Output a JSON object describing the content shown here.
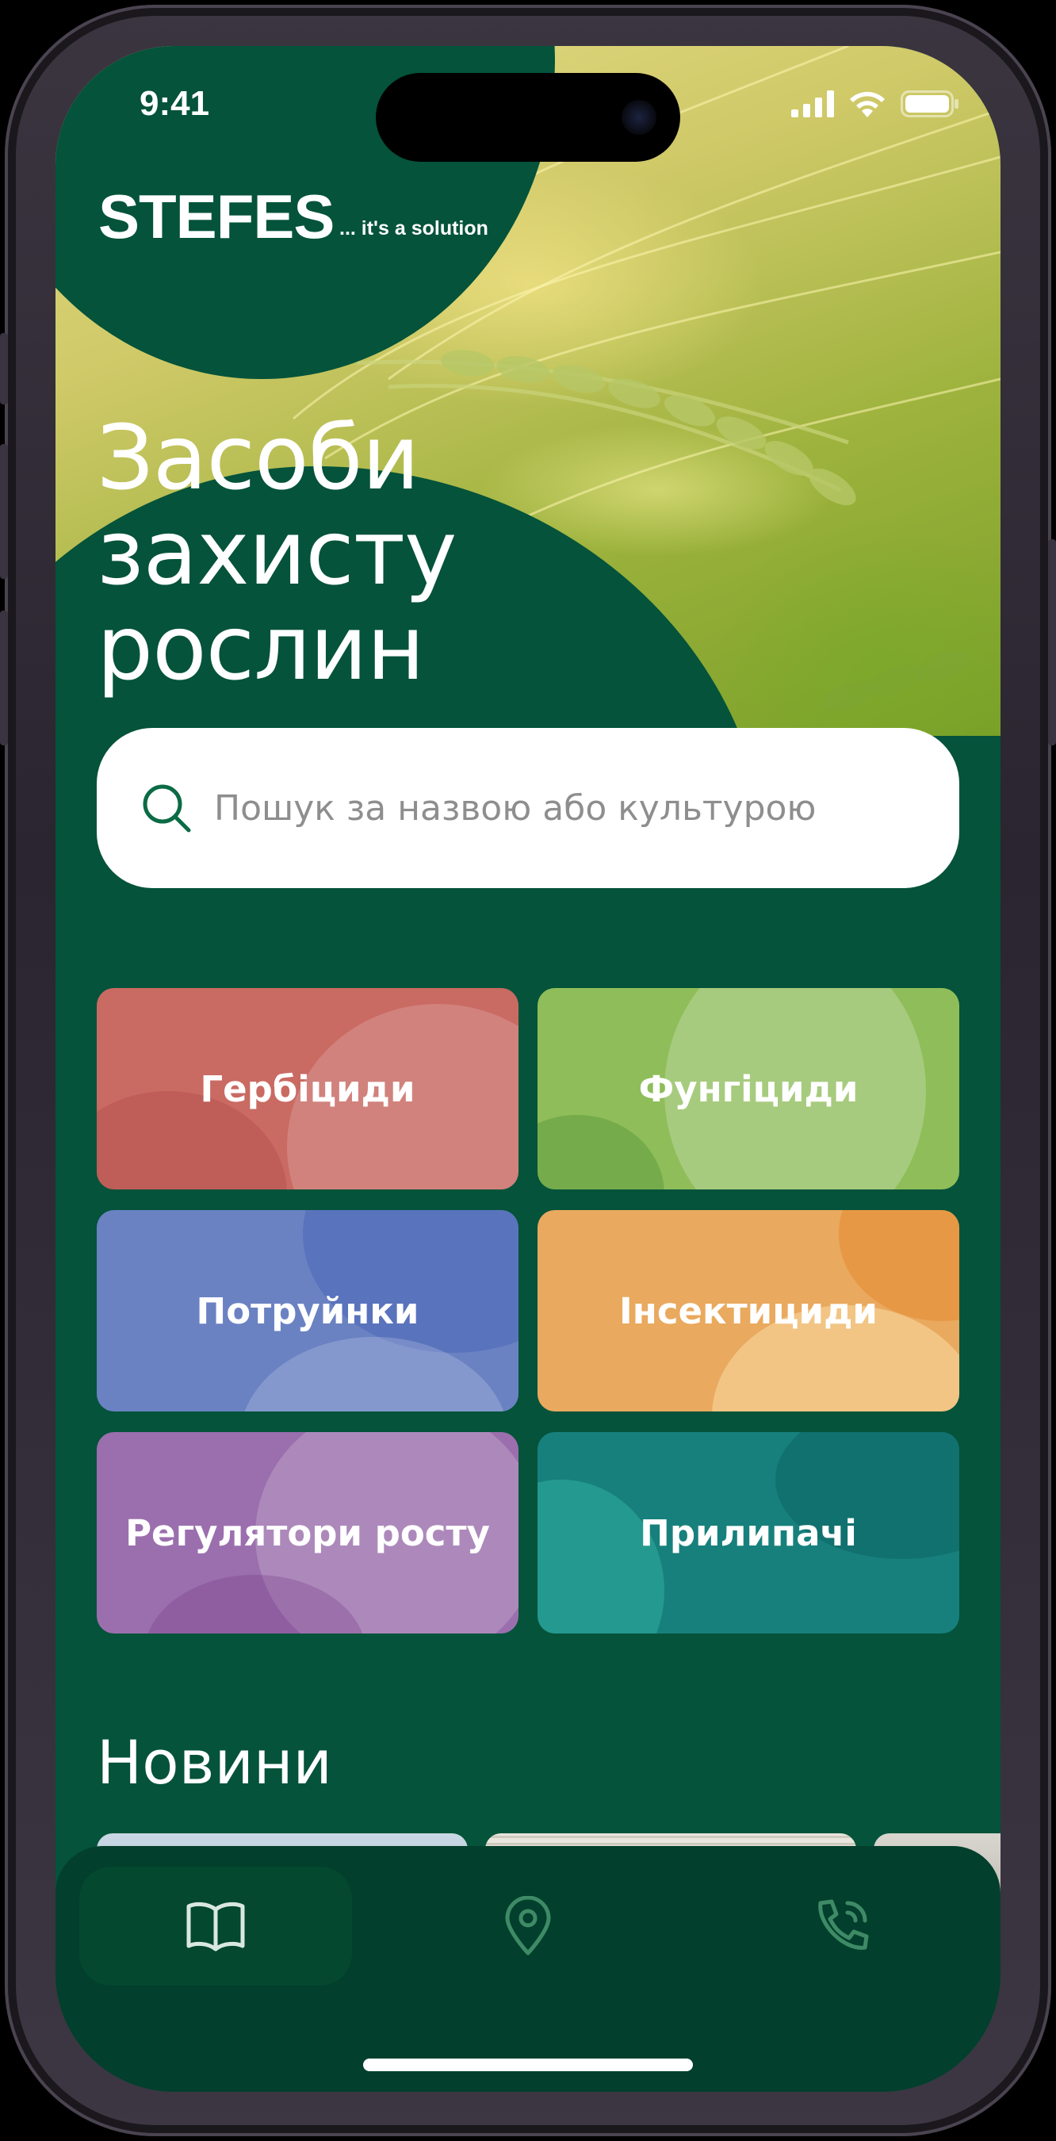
{
  "status_bar": {
    "time": "9:41"
  },
  "brand": {
    "name": "STEFES",
    "tagline": "... it's a solution"
  },
  "hero": {
    "title_lines": [
      "Засоби",
      "захисту",
      "рослин"
    ]
  },
  "search": {
    "placeholder": "Пошук за назвою або культурою"
  },
  "categories": [
    {
      "label": "Гербіциди",
      "color": "#c96a63"
    },
    {
      "label": "Фунгіциди",
      "color": "#8fbd5a"
    },
    {
      "label": "Потруйнки",
      "color": "#6a82c2"
    },
    {
      "label": "Інсектициди",
      "color": "#e9a95e"
    },
    {
      "label": "Регулятори росту",
      "color": "#9b6fad"
    },
    {
      "label": "Прилипачі",
      "color": "#17807c"
    }
  ],
  "news": {
    "title": "Новини"
  },
  "tab_bar": {
    "items": [
      {
        "icon": "book-icon",
        "active": true
      },
      {
        "icon": "map-pin-icon",
        "active": false
      },
      {
        "icon": "phone-call-icon",
        "active": false
      }
    ]
  },
  "colors": {
    "background": "#04533a",
    "tab_bar": "#023f2c",
    "accent": "#0b6b45"
  }
}
